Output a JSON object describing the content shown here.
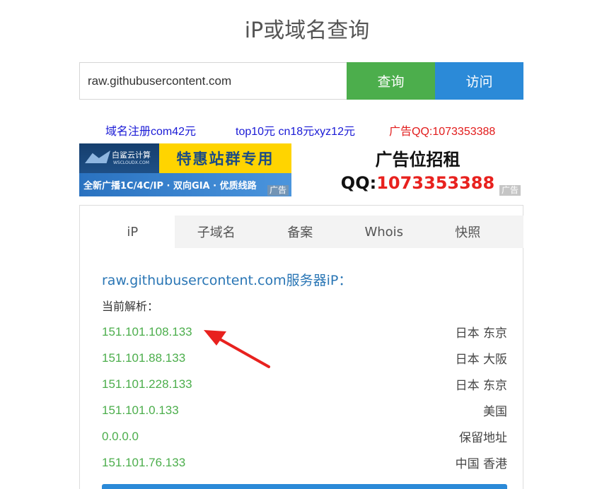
{
  "page": {
    "title": "iP或域名查询"
  },
  "search": {
    "value": "raw.githubusercontent.com",
    "query_label": "查询",
    "visit_label": "访问"
  },
  "ads": {
    "links": [
      "域名注册com42元",
      "top10元 cn18元xyz12元",
      "广告QQ:1073353388"
    ],
    "banner": {
      "logo_text": "白鲨云计算",
      "logo_sub": "WSCLOUDX.COM",
      "promo": "特惠站群专用",
      "features": "全新广播1C/4C/IP · 双向GIA · 优质线路"
    },
    "tag": "广告",
    "rent_title": "广告位招租",
    "rent_qq_label": "QQ:",
    "rent_qq_number": "1073353388"
  },
  "tabs": [
    "iP",
    "子域名",
    "备案",
    "Whois",
    "快照"
  ],
  "active_tab": "iP",
  "result": {
    "title": "raw.githubusercontent.com服务器iP：",
    "current_label": "当前解析：",
    "rows": [
      {
        "ip": "151.101.108.133",
        "location": "日本 东京"
      },
      {
        "ip": "151.101.88.133",
        "location": "日本 大阪"
      },
      {
        "ip": "151.101.228.133",
        "location": "日本 东京"
      },
      {
        "ip": "151.101.0.133",
        "location": "美国"
      },
      {
        "ip": "0.0.0.0",
        "location": "保留地址"
      },
      {
        "ip": "151.101.76.133",
        "location": "中国 香港"
      }
    ]
  },
  "colors": {
    "ip_green": "#4cae4c",
    "query_button": "#4cae4c",
    "visit_button": "#2b8ad8",
    "arrow": "#e8211e",
    "link_blue": "#1a1ad6",
    "ad_red": "#e21b1b"
  }
}
